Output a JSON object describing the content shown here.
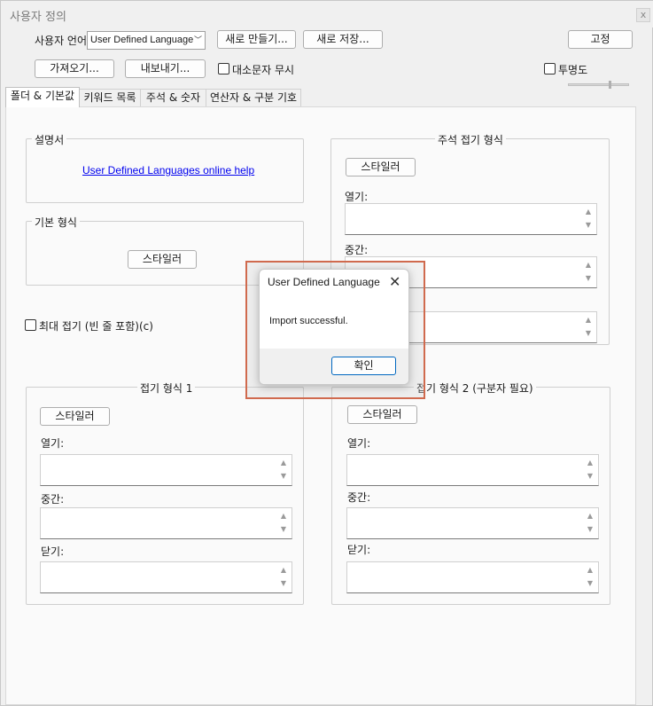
{
  "window": {
    "title": "사용자 정의",
    "close_glyph": "x"
  },
  "toolbar": {
    "language_label": "사용자 언어",
    "language_value": "User Defined Language",
    "new_button": "새로 만들기...",
    "save_as_button": "새로 저장...",
    "dock_button": "고정",
    "import_button": "가져오기...",
    "export_button": "내보내기...",
    "ignore_case_label": "대소문자 무시",
    "transparency_label": "투명도"
  },
  "tabs": [
    {
      "label": "폴더 & 기본값"
    },
    {
      "label": "키워드 목록"
    },
    {
      "label": "주석 & 숫자"
    },
    {
      "label": "연산자 & 구분 기호"
    }
  ],
  "documentation": {
    "title": "설명서",
    "link": "User Defined Languages online help"
  },
  "default_style": {
    "title": "기본 형식",
    "styler_button": "스타일러"
  },
  "fold_compact": {
    "label": "최대 접기 (빈 줄 포함)(c)"
  },
  "comment_fold": {
    "title": "주석 접기 형식",
    "styler_button": "스타일러",
    "open_label": "열기:",
    "middle_label": "중간:"
  },
  "fold1": {
    "title": "접기 형식 1",
    "styler_button": "스타일러",
    "open_label": "열기:",
    "middle_label": "중간:",
    "close_label": "닫기:"
  },
  "fold2": {
    "title": "접기 형식 2 (구분자 필요)",
    "styler_button": "스타일러",
    "open_label": "열기:",
    "middle_label": "중간:",
    "close_label": "닫기:"
  },
  "dialog": {
    "title": "User Defined Language",
    "close_glyph": "✕",
    "message": "Import successful.",
    "ok_button": "확인"
  },
  "icons": {
    "spin_up": "▲",
    "spin_down": "▼",
    "chevron": "﹀"
  },
  "colors": {
    "highlight_border": "#d06a4e",
    "link": "#0000ee",
    "dialog_ok_border": "#0067c0"
  }
}
